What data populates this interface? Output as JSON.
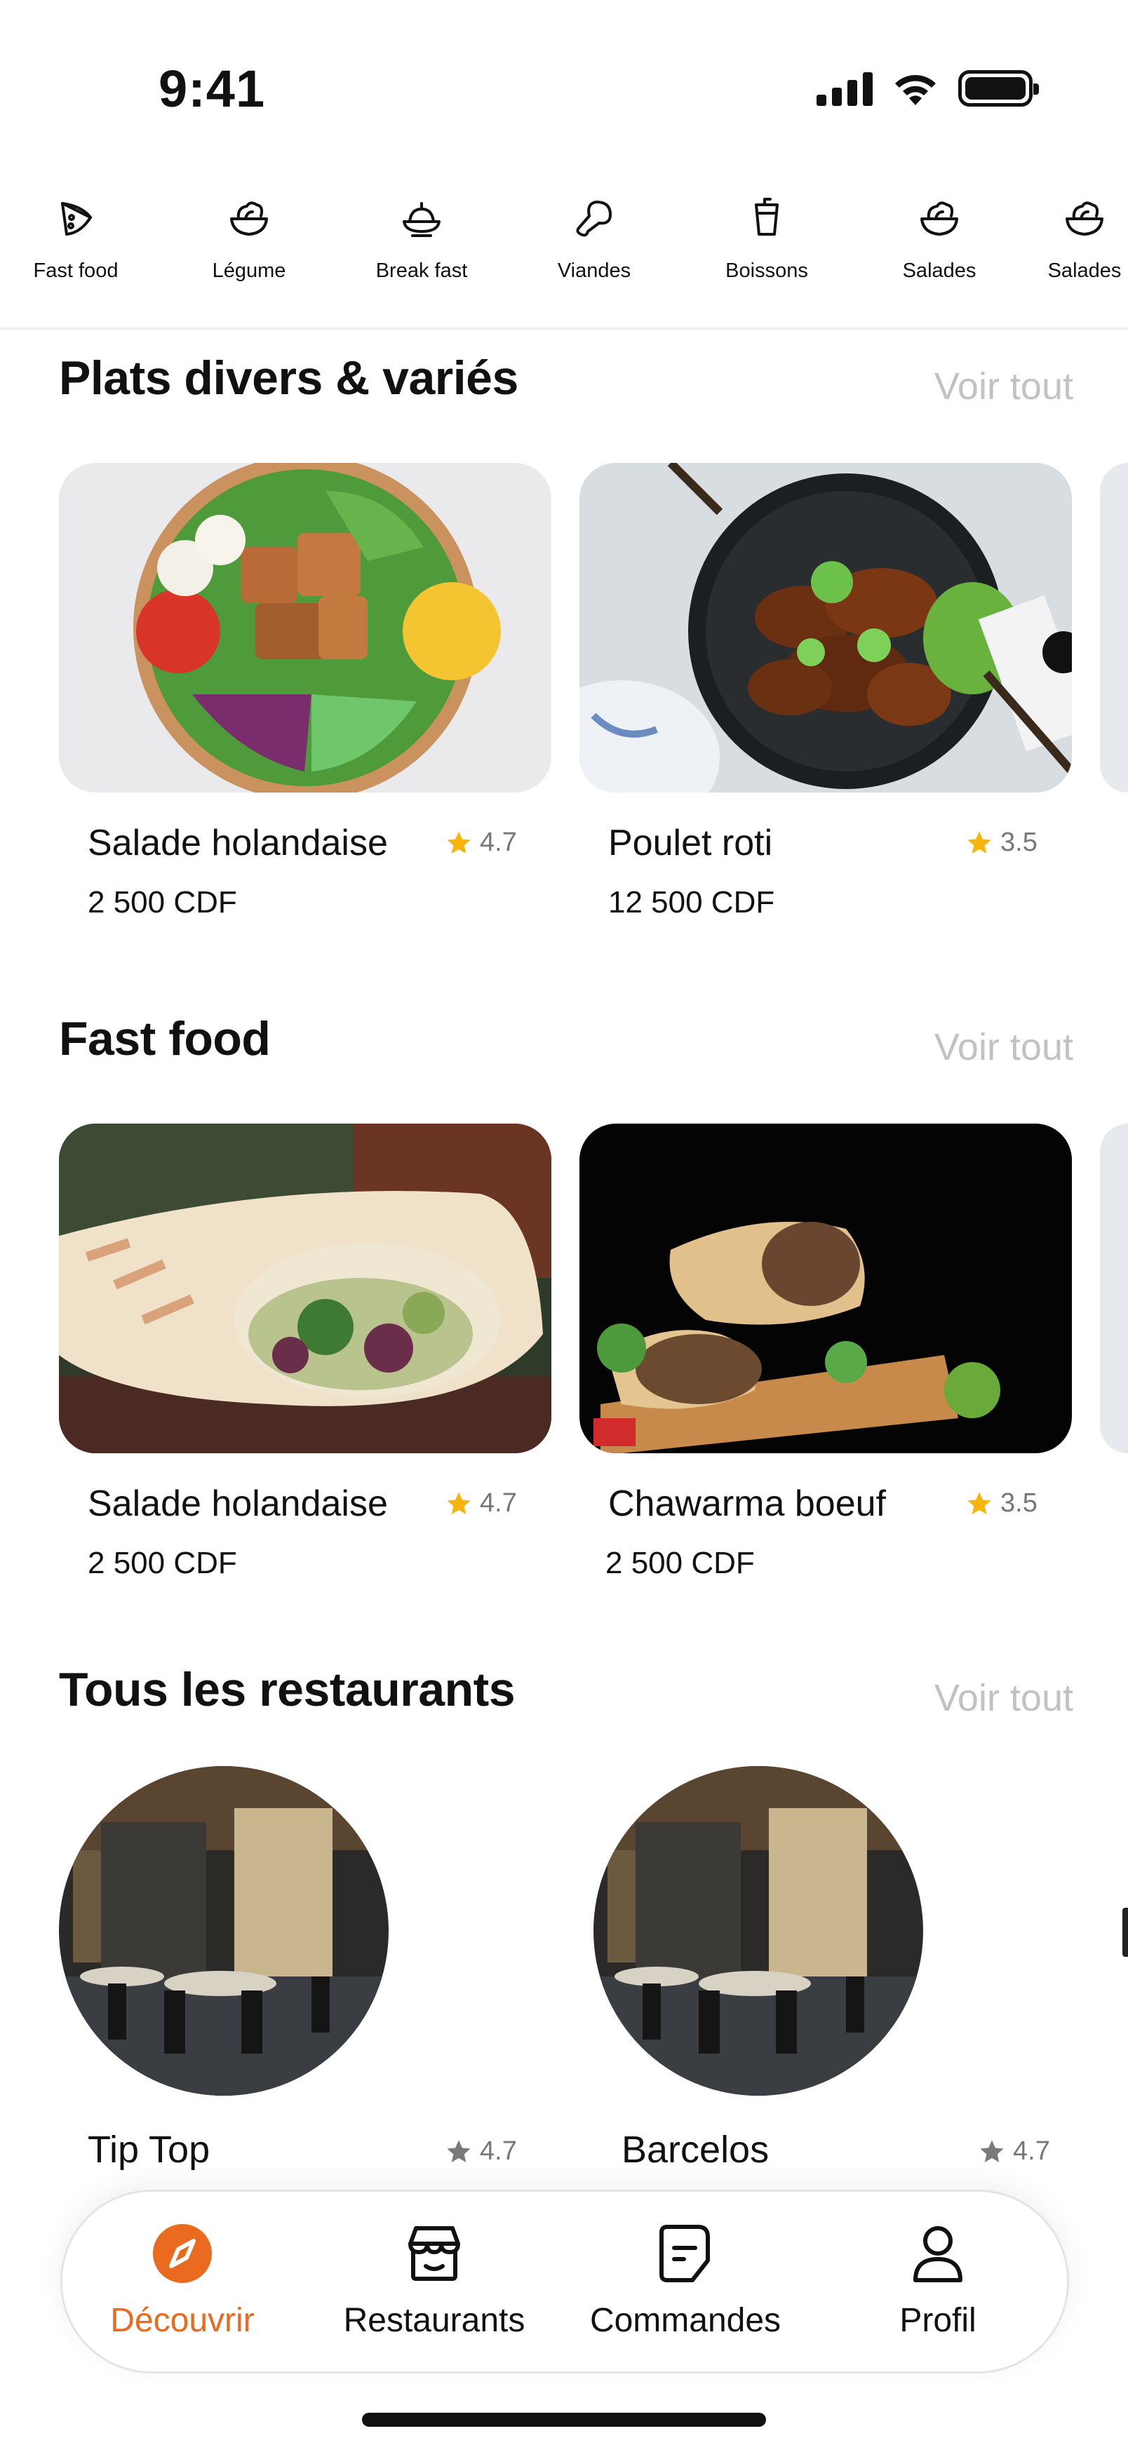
{
  "status_bar": {
    "time": "9:41"
  },
  "categories": [
    {
      "label": "Fast food",
      "icon": "pizza-slice-icon"
    },
    {
      "label": "Légume",
      "icon": "salad-bowl-icon"
    },
    {
      "label": "Break fast",
      "icon": "breakfast-icon"
    },
    {
      "label": "Viandes",
      "icon": "drumstick-icon"
    },
    {
      "label": "Boissons",
      "icon": "drink-cup-icon"
    },
    {
      "label": "Salades",
      "icon": "salad-bowl-icon"
    },
    {
      "label": "Salades",
      "icon": "salad-bowl-icon"
    }
  ],
  "sections": {
    "plats": {
      "title": "Plats divers & variés",
      "see_all": "Voir tout",
      "items": [
        {
          "name": "Salade holandaise",
          "rating": "4.7",
          "price": "2 500 CDF"
        },
        {
          "name": "Poulet roti",
          "rating": "3.5",
          "price": "12 500 CDF"
        }
      ]
    },
    "fastfood": {
      "title": "Fast food",
      "see_all": "Voir tout",
      "items": [
        {
          "name": "Salade holandaise",
          "rating": "4.7",
          "price": "2 500 CDF"
        },
        {
          "name": "Chawarma boeuf",
          "rating": "3.5",
          "price": "2 500 CDF"
        }
      ]
    },
    "restaurants": {
      "title": "Tous les restaurants",
      "see_all": "Voir tout",
      "items": [
        {
          "name": "Tip Top",
          "rating": "4.7"
        },
        {
          "name": "Barcelos",
          "rating": "4.7"
        }
      ]
    }
  },
  "tab_bar": {
    "items": [
      {
        "label": "Découvrir",
        "icon": "compass-icon",
        "active": true
      },
      {
        "label": "Restaurants",
        "icon": "storefront-icon",
        "active": false
      },
      {
        "label": "Commandes",
        "icon": "orders-icon",
        "active": false
      },
      {
        "label": "Profil",
        "icon": "user-icon",
        "active": false
      }
    ]
  },
  "colors": {
    "accent": "#ea6a1f",
    "star_gold": "#f5b50a",
    "star_gray": "#7a7a7a",
    "muted_text": "#c2c2c2"
  }
}
